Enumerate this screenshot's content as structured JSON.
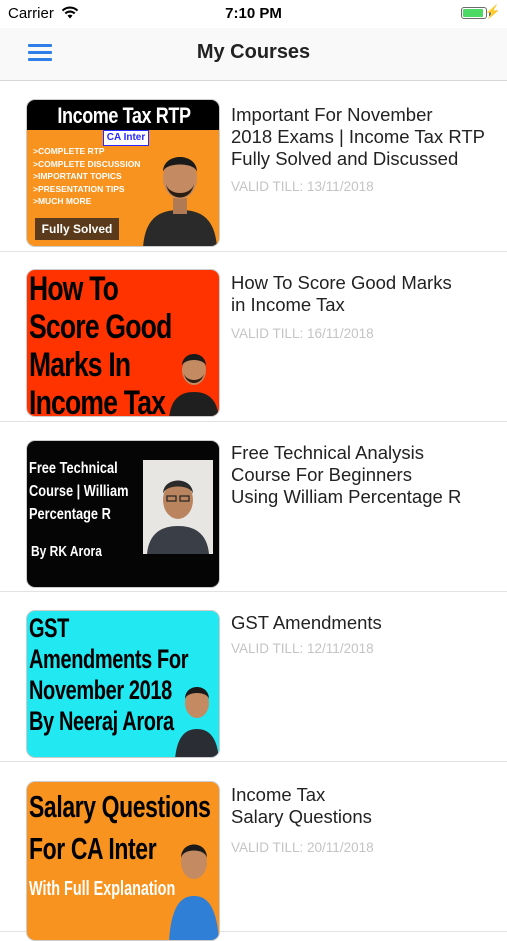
{
  "status_bar": {
    "carrier": "Carrier",
    "time": "7:10 PM",
    "battery_level": 0.9
  },
  "navbar": {
    "title": "My Courses",
    "menu_icon": "hamburger-menu-icon"
  },
  "colors": {
    "accent": "#2f7ee8",
    "valid_text": "#c4c4c4"
  },
  "courses": [
    {
      "title": "Important For November\n2018 Exams | Income Tax RTP\nFully Solved and Discussed",
      "valid": "VALID TILL: 13/11/2018",
      "thumb": {
        "heading": "Income Tax RTP",
        "badge": "CA Inter",
        "bullets": [
          "COMPLETE RTP",
          "COMPLETE DISCUSSION",
          "IMPORTANT TOPICS",
          "PRESENTATION TIPS",
          "MUCH MORE"
        ],
        "ribbon": "Fully Solved"
      }
    },
    {
      "title": "How To Score Good Marks\nin Income Tax",
      "valid": "VALID TILL: 16/11/2018",
      "thumb": {
        "lines": [
          "How To",
          "Score Good",
          "Marks In",
          "Income Tax"
        ]
      }
    },
    {
      "title": "Free Technical Analysis\nCourse For Beginners\nUsing William Percentage R",
      "valid": "",
      "thumb": {
        "lines": [
          "Free Technical",
          "Course | William",
          "Percentage R"
        ],
        "author": "By RK Arora"
      }
    },
    {
      "title": "GST Amendments",
      "valid": "VALID TILL: 12/11/2018",
      "thumb": {
        "lines": [
          "GST",
          "Amendments For",
          "November 2018",
          "By Neeraj Arora"
        ]
      }
    },
    {
      "title": "Income Tax\nSalary Questions",
      "valid": "VALID TILL: 20/11/2018",
      "thumb": {
        "lines": [
          "Salary Questions",
          "For CA Inter",
          "With Full Explanation"
        ]
      }
    }
  ]
}
